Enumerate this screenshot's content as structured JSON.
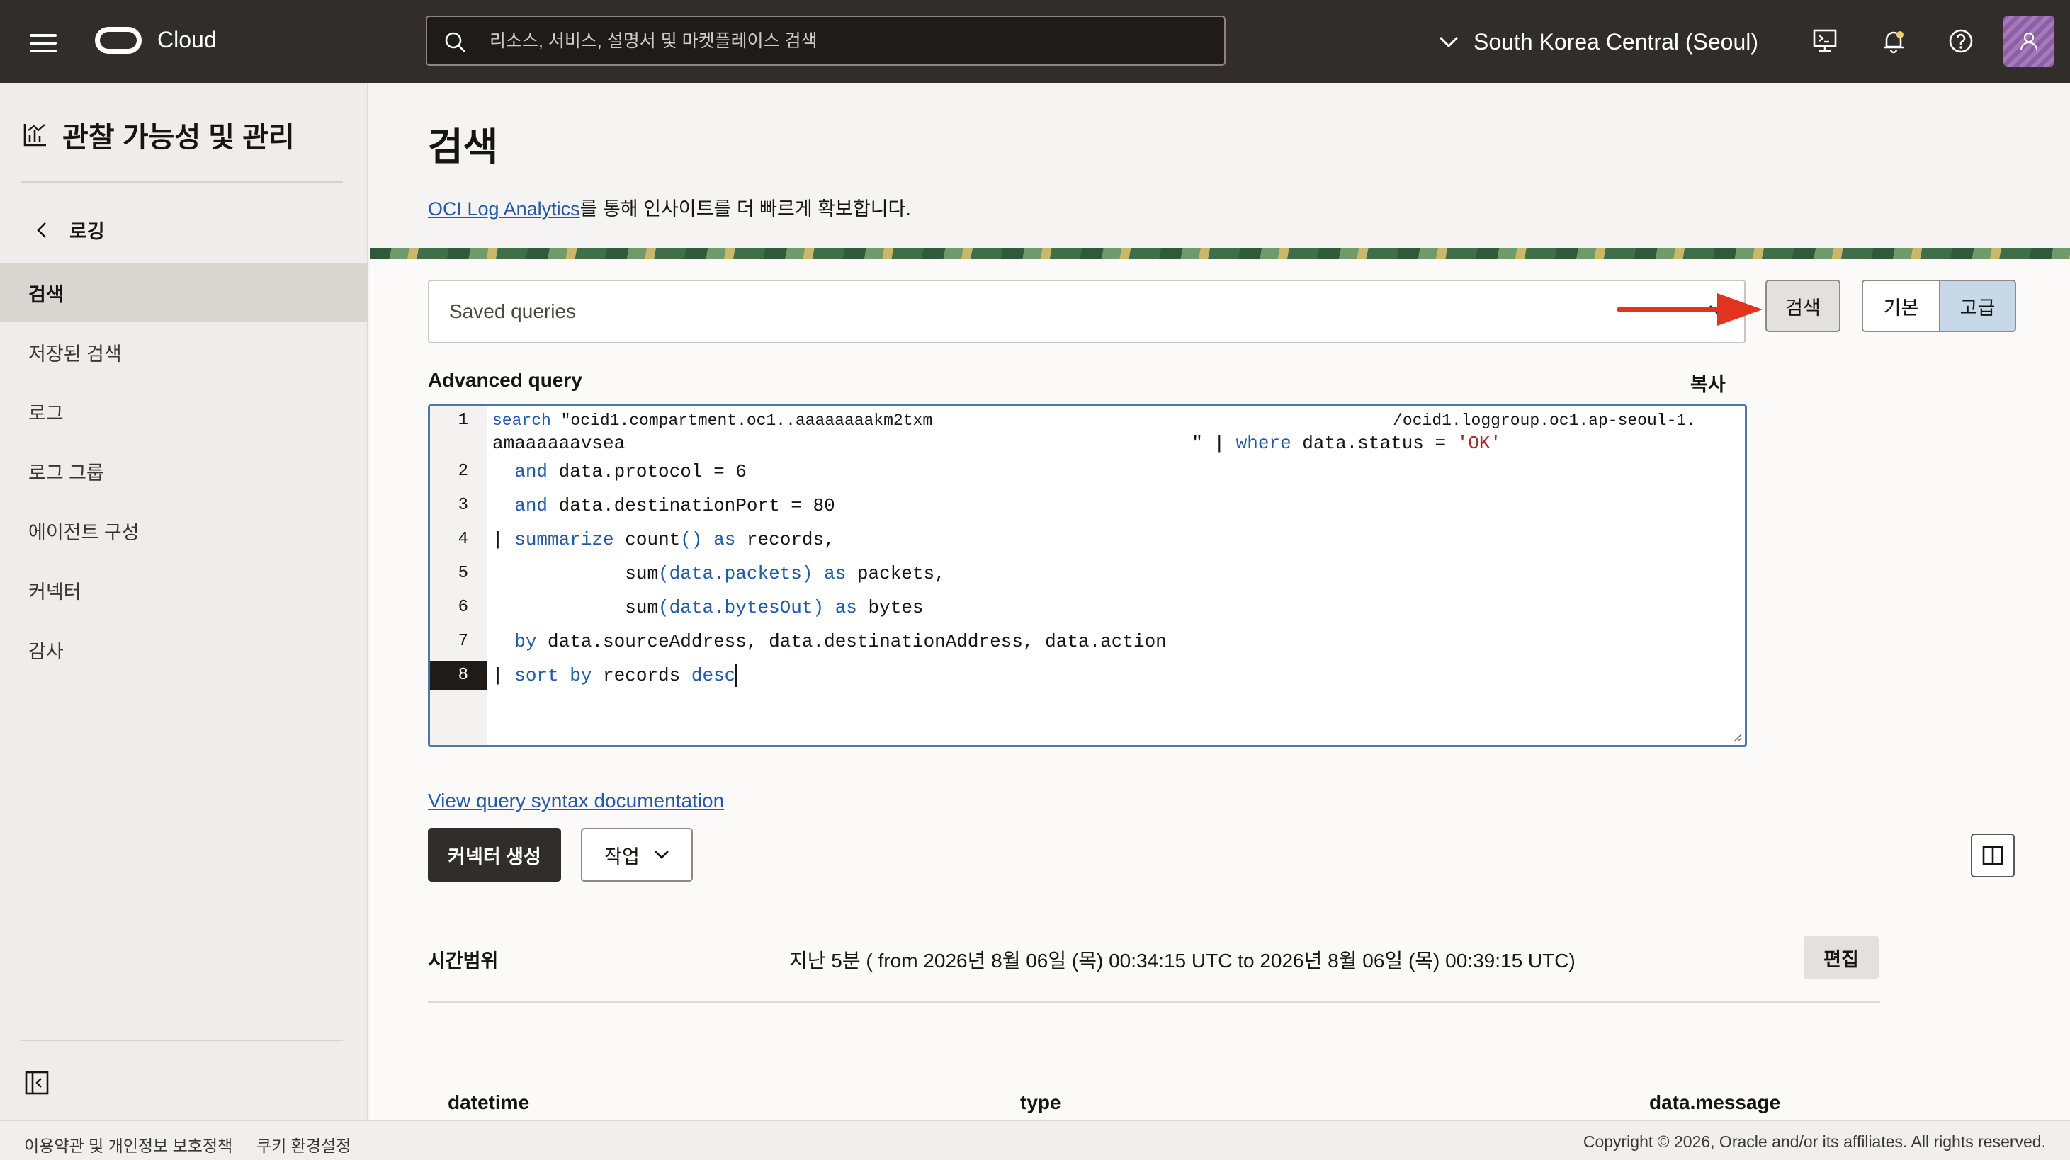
{
  "header": {
    "brand": "Cloud",
    "search_placeholder": "리소스, 서비스, 설명서 및 마켓플레이스 검색",
    "region": "South Korea Central (Seoul)"
  },
  "sidebar": {
    "title": "관찰 가능성 및 관리",
    "back_label": "로깅",
    "items": [
      {
        "label": "검색",
        "active": true
      },
      {
        "label": "저장된 검색"
      },
      {
        "label": "로그"
      },
      {
        "label": "로그 그룹"
      },
      {
        "label": "에이전트 구성"
      },
      {
        "label": "커넥터"
      },
      {
        "label": "감사"
      }
    ]
  },
  "main": {
    "title": "검색",
    "promo_link": "OCI Log Analytics",
    "promo_text": "를 통해 인사이트를 더 빠르게 확보합니다.",
    "saved_queries_placeholder": "Saved queries",
    "search_button": "검색",
    "mode_basic": "기본",
    "mode_advanced": "고급",
    "advanced_query_label": "Advanced query",
    "copy_label": "복사",
    "editor": {
      "line_numbers": [
        "1",
        "2",
        "3",
        "4",
        "5",
        "6",
        "7",
        "8"
      ],
      "line1_kw": "search",
      "line1_a": " \"ocid1.compartment.oc1..aaaaaaaakm2txm",
      "line1_b": "/ocid1.loggroup.oc1.ap-seoul-1.",
      "line1_wrap_a": "amaaaaaavsea",
      "line1_wrap_b": "\" | ",
      "line1_wrap_kw": "where",
      "line1_wrap_c": " data.status = ",
      "line1_wrap_str": "'OK'",
      "line2_kw": "and",
      "line2_rest": " data.protocol = 6",
      "line3_kw": "and",
      "line3_rest": " data.destinationPort = 80",
      "line4_pipe": "| ",
      "line4_kw": "summarize",
      "line4_a": " count",
      "line4_b": "()",
      "line4_kw2": " as",
      "line4_c": " records,",
      "line5_a": "sum",
      "line5_b": "(data.packets)",
      "line5_kw": " as",
      "line5_c": " packets,",
      "line6_a": "sum",
      "line6_b": "(data.bytesOut)",
      "line6_kw": " as",
      "line6_c": " bytes",
      "line7_kw": "by",
      "line7_rest": " data.sourceAddress, data.destinationAddress, data.action",
      "line8_pipe": "| ",
      "line8_kw": "sort by",
      "line8_a": " records ",
      "line8_kw2": "desc"
    },
    "doc_link": "View query syntax documentation",
    "create_connector": "커넥터 생성",
    "actions": "작업",
    "time_range_label": "시간범위",
    "time_range_value": "지난 5분 ( from 2026년 8월 06일 (목) 00:34:15 UTC to 2026년 8월 06일 (목) 00:39:15 UTC)",
    "edit_button": "편집",
    "columns": [
      "datetime",
      "type",
      "data.message"
    ]
  },
  "footer": {
    "terms": "이용약관 및 개인정보 보호정책",
    "cookies": "쿠키 환경설정",
    "copyright": "Copyright © 2026, Oracle and/or its affiliates. All rights reserved."
  },
  "colors": {
    "header_bg": "#312d2a",
    "link": "#225aa6",
    "keyword": "#225aa6",
    "string": "#a3262a",
    "annotation_arrow": "#e0341f",
    "editor_border": "#4a78a8"
  }
}
